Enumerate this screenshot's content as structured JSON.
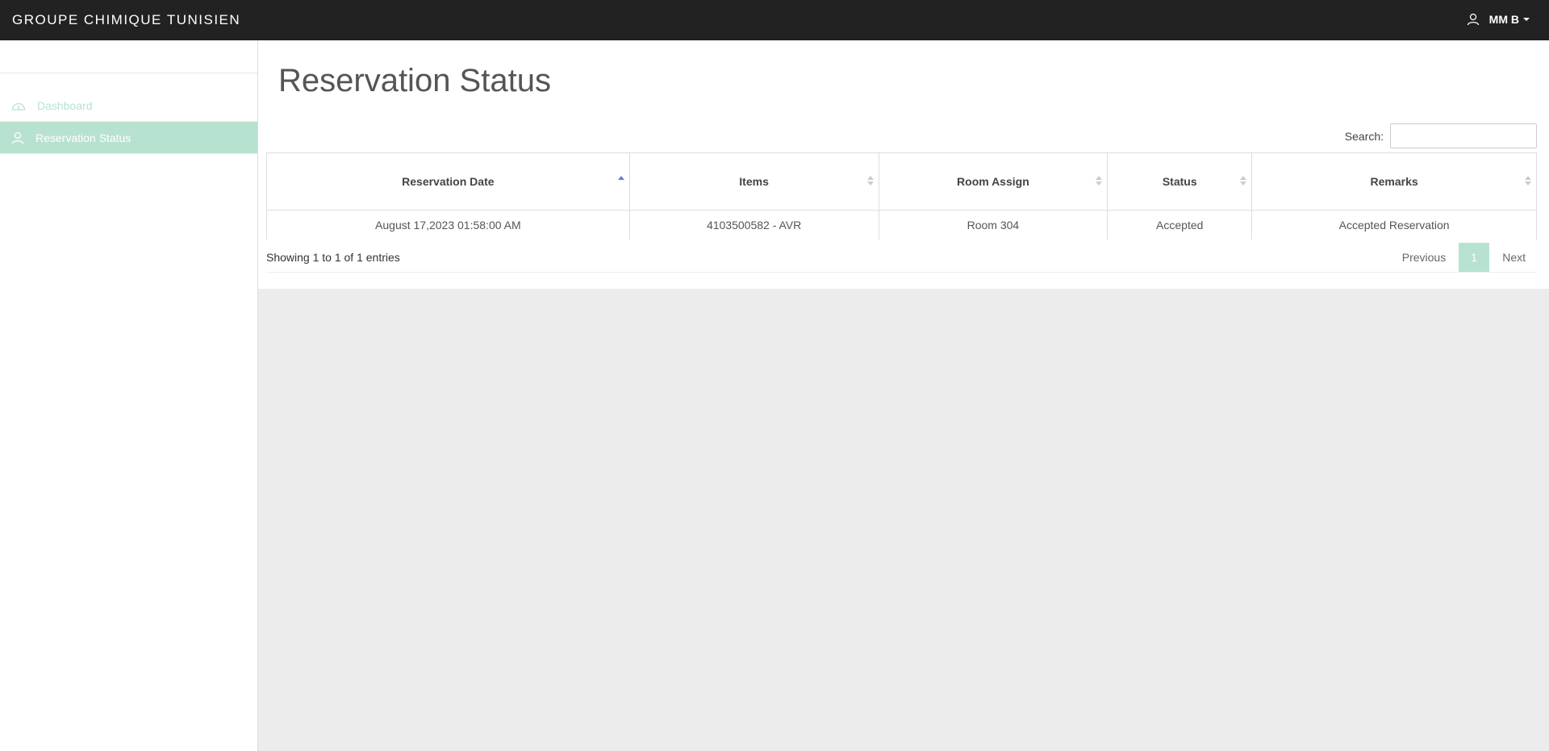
{
  "header": {
    "brand": "GROUPE CHIMIQUE TUNISIEN",
    "user_name": "MM B"
  },
  "sidebar": {
    "items": [
      {
        "label": "Dashboard",
        "icon": "dashboard-icon",
        "active": false
      },
      {
        "label": "Reservation Status",
        "icon": "user-icon",
        "active": true
      }
    ]
  },
  "main": {
    "title": "Reservation Status",
    "search_label": "Search:",
    "search_value": "",
    "table": {
      "columns": [
        "Reservation Date",
        "Items",
        "Room Assign",
        "Status",
        "Remarks"
      ],
      "rows": [
        [
          "August 17,2023 01:58:00 AM",
          "4103500582 - AVR",
          "Room 304",
          "Accepted",
          "Accepted Reservation"
        ]
      ]
    },
    "info": "Showing 1 to 1 of 1 entries",
    "pagination": {
      "previous": "Previous",
      "current": "1",
      "next": "Next"
    }
  },
  "colors": {
    "navbar": "#222222",
    "accent": "#b8e2d0",
    "sort_active": "#6c7cd0",
    "background": "#ececec"
  }
}
